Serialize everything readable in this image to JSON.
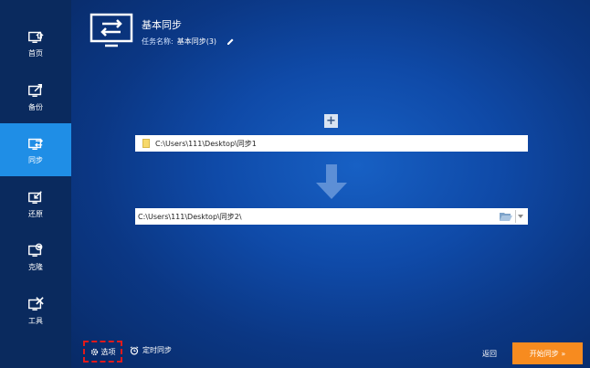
{
  "sidebar": {
    "items": [
      {
        "label": "首页",
        "icon": "home-icon"
      },
      {
        "label": "备份",
        "icon": "backup-icon"
      },
      {
        "label": "同步",
        "icon": "sync-icon",
        "active": true
      },
      {
        "label": "还原",
        "icon": "restore-icon"
      },
      {
        "label": "克隆",
        "icon": "clone-icon"
      },
      {
        "label": "工具",
        "icon": "tools-icon"
      }
    ]
  },
  "header": {
    "title": "基本同步",
    "task_label": "任务名称:",
    "task_name": "基本同步(3)"
  },
  "source": {
    "path": "C:\\Users\\111\\Desktop\\同步1"
  },
  "destination": {
    "path": "C:\\Users\\111\\Desktop\\同步2\\"
  },
  "footer": {
    "options_label": "选项",
    "schedule_label": "定时同步",
    "back_label": "返回",
    "start_label": "开始同步 »"
  },
  "colors": {
    "accent": "#1f8ee6",
    "start_button": "#f78b1f",
    "highlight_border": "#e21a1a"
  }
}
